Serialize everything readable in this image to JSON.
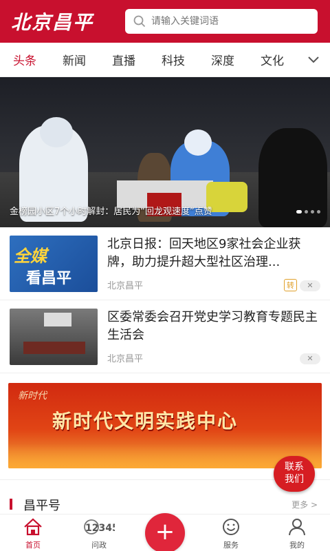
{
  "header": {
    "logo": "北京昌平",
    "search_placeholder": "请输入关键词语"
  },
  "tabs": [
    {
      "label": "头条",
      "active": true
    },
    {
      "label": "新闻"
    },
    {
      "label": "直播"
    },
    {
      "label": "科技"
    },
    {
      "label": "深度"
    },
    {
      "label": "文化"
    }
  ],
  "hero": {
    "caption": "金榜园小区7个小时解封：居民为“回龙观速度”点赞",
    "slides_count": 4,
    "active_slide": 1
  },
  "news": [
    {
      "thumb_line1": "全媒",
      "thumb_line2": "看昌平",
      "title": "北京日报：回天地区9家社会企业获牌，助力提升超大型社区治理...",
      "source": "北京昌平",
      "tag": "转"
    },
    {
      "title": "区委常委会召开党史学习教育专题民主生活会",
      "source": "北京昌平"
    }
  ],
  "banner": {
    "seal": "新时代",
    "title": "新时代文明实践中心"
  },
  "float_contact": {
    "line1": "联系",
    "line2": "我们"
  },
  "section": {
    "title": "昌平号",
    "more": "更多 >"
  },
  "bottom_nav": [
    {
      "label": "首页",
      "icon": "home-icon",
      "active": true
    },
    {
      "label": "问政",
      "icon": "hotline-12345-icon",
      "icon_text": "12345"
    },
    {
      "label": "",
      "icon": "plus-icon"
    },
    {
      "label": "服务",
      "icon": "smiley-icon"
    },
    {
      "label": "我的",
      "icon": "user-icon"
    }
  ],
  "colors": {
    "brand_red": "#c8102e",
    "tag_orange": "#e0a02a"
  }
}
